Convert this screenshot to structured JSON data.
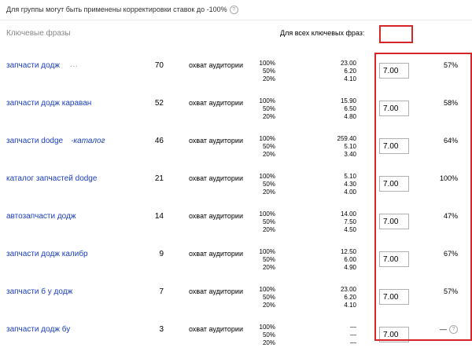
{
  "notice": "Для группы могут быть применены корректировки ставок до -100%",
  "notice_help": "?",
  "headers": {
    "keywords": "Ключевые фразы",
    "all_keywords": "Для всех ключевых фраз:"
  },
  "reach_label": "охват аудитории",
  "percent_levels": [
    "100%",
    "50%",
    "20%"
  ],
  "accent_color": "#d5262a",
  "link_color": "#1a3dc1",
  "rows": [
    {
      "keyword": "запчасти додж",
      "negative": "",
      "more": "···",
      "count": "70",
      "bids": [
        "23.00",
        "6.20",
        "4.10"
      ],
      "bid": "7.00",
      "share": "57%",
      "share_help": ""
    },
    {
      "keyword": "запчасти додж караван",
      "negative": "",
      "more": "",
      "count": "52",
      "bids": [
        "15.90",
        "6.50",
        "4.80"
      ],
      "bid": "7.00",
      "share": "58%",
      "share_help": ""
    },
    {
      "keyword": "запчасти dodge",
      "negative": "-каталог",
      "more": "",
      "count": "46",
      "bids": [
        "259.40",
        "5.10",
        "3.40"
      ],
      "bid": "7.00",
      "share": "64%",
      "share_help": ""
    },
    {
      "keyword": "каталог запчастей dodge",
      "negative": "",
      "more": "",
      "count": "21",
      "bids": [
        "5.10",
        "4.30",
        "4.00"
      ],
      "bid": "7.00",
      "share": "100%",
      "share_help": ""
    },
    {
      "keyword": "автозапчасти додж",
      "negative": "",
      "more": "",
      "count": "14",
      "bids": [
        "14.00",
        "7.50",
        "4.50"
      ],
      "bid": "7.00",
      "share": "47%",
      "share_help": ""
    },
    {
      "keyword": "запчасти додж калибр",
      "negative": "",
      "more": "",
      "count": "9",
      "bids": [
        "12.50",
        "6.00",
        "4.90"
      ],
      "bid": "7.00",
      "share": "67%",
      "share_help": ""
    },
    {
      "keyword": "запчасти б у додж",
      "negative": "",
      "more": "",
      "count": "7",
      "bids": [
        "23.00",
        "6.20",
        "4.10"
      ],
      "bid": "7.00",
      "share": "57%",
      "share_help": ""
    },
    {
      "keyword": "запчасти додж бу",
      "negative": "",
      "more": "",
      "count": "3",
      "bids": [
        "—",
        "—",
        "—"
      ],
      "bid": "7.00",
      "share": "—",
      "share_help": "?"
    }
  ]
}
